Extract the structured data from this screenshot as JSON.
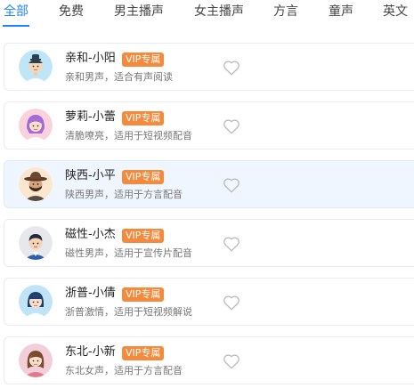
{
  "tabs": [
    {
      "label": "全部",
      "active": true
    },
    {
      "label": "免费",
      "active": false
    },
    {
      "label": "男主播声",
      "active": false
    },
    {
      "label": "女主播声",
      "active": false
    },
    {
      "label": "方言",
      "active": false
    },
    {
      "label": "童声",
      "active": false
    },
    {
      "label": "英文",
      "active": false
    }
  ],
  "badge_label": "VIP专属",
  "accent_color": "#1f84ff",
  "badge_color": "#f68a3c",
  "voices": [
    {
      "name": "亲和-小阳",
      "desc": "亲和男声，适合有声阅读",
      "avatar_icon": "avatar-boy-hat-icon"
    },
    {
      "name": "萝莉-小蕾",
      "desc": "清脆嘹亮，适用于短视频配音",
      "avatar_icon": "avatar-girl-purple-hair-icon"
    },
    {
      "name": "陕西-小平",
      "desc": "陕西男声，适用于方言配音",
      "avatar_icon": "avatar-man-cowboy-hat-icon",
      "selected": true
    },
    {
      "name": "磁性-小杰",
      "desc": "磁性男声，适用于宣传片配音",
      "avatar_icon": "avatar-man-suit-icon"
    },
    {
      "name": "浙普-小倩",
      "desc": "浙普激情，适用于短视频解说",
      "avatar_icon": "avatar-girl-blue-bob-icon"
    },
    {
      "name": "东北-小新",
      "desc": "东北女声，适用于方言配音",
      "avatar_icon": "avatar-woman-brown-hair-icon"
    }
  ]
}
